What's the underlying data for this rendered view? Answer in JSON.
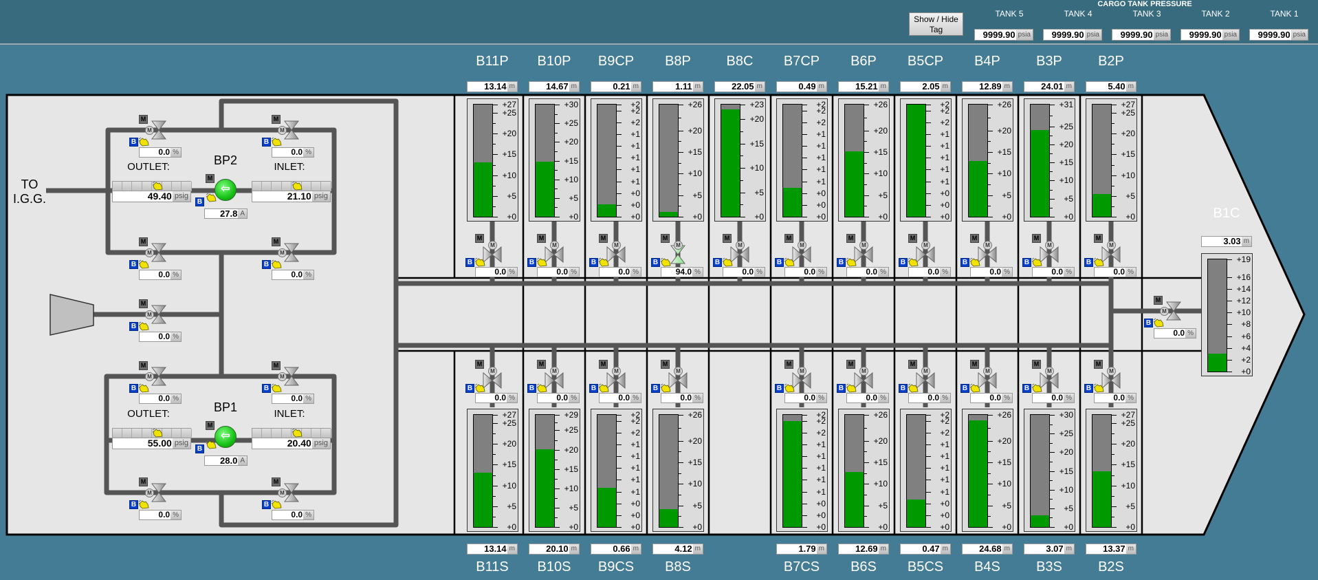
{
  "colors": {
    "header_bg": "#386b7d",
    "main_bg": "#437c94",
    "hull": "#e6e6e6",
    "level_fill": "#009900",
    "level_empty": "#808080",
    "valve_open": "#7fe87f",
    "valve_closed": "#8a8a8a",
    "pump_running": "#17c117",
    "badge_b": "#0a3fc9",
    "hand_icon": "#f2e200"
  },
  "header": {
    "show_hide_tag": "Show / Hide Tag",
    "cargo_tank_pressure": {
      "title": "CARGO TANK PRESSURE",
      "tanks": [
        {
          "label": "TANK 5",
          "value": "9999.90",
          "unit": "psia"
        },
        {
          "label": "TANK 4",
          "value": "9999.90",
          "unit": "psia"
        },
        {
          "label": "TANK 3",
          "value": "9999.90",
          "unit": "psia"
        },
        {
          "label": "TANK 2",
          "value": "9999.90",
          "unit": "psia"
        },
        {
          "label": "TANK 1",
          "value": "9999.90",
          "unit": "psia"
        }
      ]
    }
  },
  "badges": {
    "mode": "M",
    "motor": "M",
    "b": "B"
  },
  "pump_room": {
    "to_igg": "TO I.G.G.",
    "pumps": [
      {
        "name": "BP2",
        "outlet_label": "OUTLET:",
        "inlet_label": "INLET:",
        "outlet": "49.40",
        "inlet": "21.10",
        "pressure_unit": "psig",
        "current": "27.8",
        "current_unit": "A",
        "state": "running"
      },
      {
        "name": "BP1",
        "outlet_label": "OUTLET:",
        "inlet_label": "INLET:",
        "outlet": "55.00",
        "inlet": "20.40",
        "pressure_unit": "psig",
        "current": "28.0",
        "current_unit": "A",
        "state": "running"
      }
    ],
    "valves": [
      {
        "id": "bp2-outlet-upper",
        "value": "0.0",
        "unit": "%",
        "state": "closed"
      },
      {
        "id": "bp2-inlet-upper",
        "value": "0.0",
        "unit": "%",
        "state": "closed"
      },
      {
        "id": "bp2-outlet-lower",
        "value": "0.0",
        "unit": "%",
        "state": "closed"
      },
      {
        "id": "bp2-inlet-lower",
        "value": "0.0",
        "unit": "%",
        "state": "closed"
      },
      {
        "id": "compressor",
        "value": "0.0",
        "unit": "%",
        "state": "closed"
      },
      {
        "id": "bp1-outlet-upper",
        "value": "0.0",
        "unit": "%",
        "state": "closed"
      },
      {
        "id": "bp1-inlet-upper",
        "value": "0.0",
        "unit": "%",
        "state": "closed"
      },
      {
        "id": "bp1-outlet-lower",
        "value": "0.0",
        "unit": "%",
        "state": "closed"
      },
      {
        "id": "bp1-inlet-lower",
        "value": "0.0",
        "unit": "%",
        "state": "closed"
      }
    ]
  },
  "scales": {
    "s27": {
      "max": 27,
      "ticks": [
        27,
        25,
        20,
        15,
        10,
        5,
        0
      ],
      "labels": [
        "+27",
        "+25",
        "+20",
        "+15",
        "+10",
        "+5",
        "+0"
      ]
    },
    "s30": {
      "max": 30,
      "ticks": [
        30,
        25,
        20,
        15,
        10,
        5,
        0
      ],
      "labels": [
        "+30",
        "+25",
        "+20",
        "+15",
        "+10",
        "+5",
        "+0"
      ]
    },
    "s31": {
      "max": 31,
      "ticks": [
        31,
        25,
        20,
        15,
        10,
        5,
        0
      ],
      "labels": [
        "+31",
        "+25",
        "+20",
        "+15",
        "+10",
        "+5",
        "+0"
      ]
    },
    "s29": {
      "max": 29,
      "ticks": [
        29,
        25,
        20,
        15,
        10,
        5,
        0
      ],
      "labels": [
        "+29",
        "+25",
        "+20",
        "+15",
        "+10",
        "+5",
        "+0"
      ]
    },
    "s26": {
      "max": 26,
      "ticks": [
        26,
        20,
        15,
        10,
        5,
        0
      ],
      "labels": [
        "+26",
        "+20",
        "+15",
        "+10",
        "+5",
        "+0"
      ]
    },
    "s23": {
      "max": 23,
      "ticks": [
        23,
        20,
        15,
        10,
        5,
        0
      ],
      "labels": [
        "+23",
        "+20",
        "+15",
        "+10",
        "+5",
        "+0"
      ]
    },
    "s19": {
      "max": 19,
      "ticks": [
        19,
        16,
        14,
        12,
        10,
        8,
        6,
        4,
        2,
        0
      ],
      "labels": [
        "+19",
        "+16",
        "+14",
        "+12",
        "+10",
        "+8",
        "+6",
        "+4",
        "+2",
        "+0"
      ]
    },
    "s2": {
      "max": 1.9,
      "ticks": [
        1.9,
        1.8,
        1.6,
        1.4,
        1.2,
        1.0,
        0.8,
        0.6,
        0.4,
        0.2,
        0
      ],
      "labels": [
        "+2",
        "+2",
        "+2",
        "+1",
        "+1",
        "+1",
        "+1",
        "+1",
        "+0",
        "+0",
        "+0"
      ]
    }
  },
  "tanks_port": [
    {
      "name": "B11P",
      "level": "13.14",
      "unit": "m",
      "scale": "s27",
      "valve": "0.0",
      "valve_unit": "%",
      "valve_state": "closed"
    },
    {
      "name": "B10P",
      "level": "14.67",
      "unit": "m",
      "scale": "s30",
      "valve": "0.0",
      "valve_unit": "%",
      "valve_state": "closed"
    },
    {
      "name": "B9CP",
      "level": "0.21",
      "unit": "m",
      "scale": "s2",
      "valve": "0.0",
      "valve_unit": "%",
      "valve_state": "closed"
    },
    {
      "name": "B8P",
      "level": "1.11",
      "unit": "m",
      "scale": "s26",
      "valve": "94.0",
      "valve_unit": "%",
      "valve_state": "open"
    },
    {
      "name": "B8C",
      "level": "22.05",
      "unit": "m",
      "scale": "s23",
      "valve": "0.0",
      "valve_unit": "%",
      "valve_state": "closed"
    },
    {
      "name": "B7CP",
      "level": "0.49",
      "unit": "m",
      "scale": "s2",
      "valve": "0.0",
      "valve_unit": "%",
      "valve_state": "closed"
    },
    {
      "name": "B6P",
      "level": "15.21",
      "unit": "m",
      "scale": "s26",
      "valve": "0.0",
      "valve_unit": "%",
      "valve_state": "closed"
    },
    {
      "name": "B5CP",
      "level": "2.05",
      "unit": "m",
      "scale": "s2",
      "valve": "0.0",
      "valve_unit": "%",
      "valve_state": "closed"
    },
    {
      "name": "B4P",
      "level": "12.89",
      "unit": "m",
      "scale": "s26",
      "valve": "0.0",
      "valve_unit": "%",
      "valve_state": "closed"
    },
    {
      "name": "B3P",
      "level": "24.01",
      "unit": "m",
      "scale": "s31",
      "valve": "0.0",
      "valve_unit": "%",
      "valve_state": "closed"
    },
    {
      "name": "B2P",
      "level": "5.40",
      "unit": "m",
      "scale": "s27",
      "valve": "0.0",
      "valve_unit": "%",
      "valve_state": "closed"
    }
  ],
  "tanks_stbd": [
    {
      "name": "B11S",
      "level": "13.14",
      "unit": "m",
      "scale": "s27",
      "valve": "0.0",
      "valve_unit": "%",
      "valve_state": "closed"
    },
    {
      "name": "B10S",
      "level": "20.10",
      "unit": "m",
      "scale": "s29",
      "valve": "0.0",
      "valve_unit": "%",
      "valve_state": "closed"
    },
    {
      "name": "B9CS",
      "level": "0.66",
      "unit": "m",
      "scale": "s2",
      "valve": "0.0",
      "valve_unit": "%",
      "valve_state": "closed"
    },
    {
      "name": "B8S",
      "level": "4.12",
      "unit": "m",
      "scale": "s26",
      "valve": "0.0",
      "valve_unit": "%",
      "valve_state": "closed"
    },
    null,
    {
      "name": "B7CS",
      "level": "1.79",
      "unit": "m",
      "scale": "s2",
      "valve": "0.0",
      "valve_unit": "%",
      "valve_state": "closed"
    },
    {
      "name": "B6S",
      "level": "12.69",
      "unit": "m",
      "scale": "s26",
      "valve": "0.0",
      "valve_unit": "%",
      "valve_state": "closed"
    },
    {
      "name": "B5CS",
      "level": "0.47",
      "unit": "m",
      "scale": "s2",
      "valve": "0.0",
      "valve_unit": "%",
      "valve_state": "closed"
    },
    {
      "name": "B4S",
      "level": "24.68",
      "unit": "m",
      "scale": "s26",
      "valve": "0.0",
      "valve_unit": "%",
      "valve_state": "closed"
    },
    {
      "name": "B3S",
      "level": "3.07",
      "unit": "m",
      "scale": "s30",
      "valve": "0.0",
      "valve_unit": "%",
      "valve_state": "closed"
    },
    {
      "name": "B2S",
      "level": "13.37",
      "unit": "m",
      "scale": "s27",
      "valve": "0.0",
      "valve_unit": "%",
      "valve_state": "closed"
    }
  ],
  "tank_b1c": {
    "name": "B1C",
    "level": "3.03",
    "unit": "m",
    "scale": "s19",
    "valve": "0.0",
    "valve_unit": "%",
    "valve_state": "closed"
  }
}
